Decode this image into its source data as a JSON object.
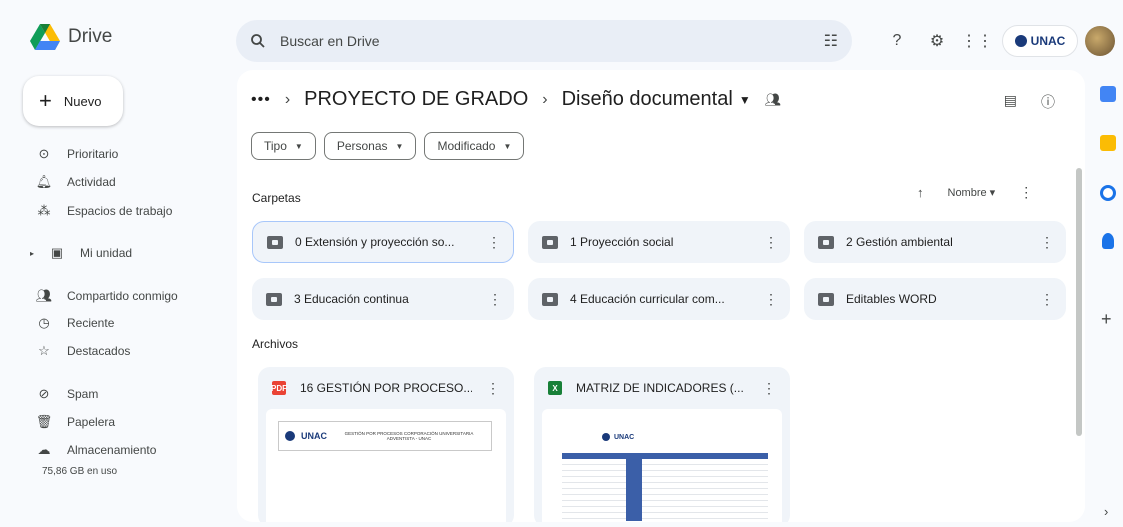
{
  "app": {
    "name": "Drive"
  },
  "search": {
    "placeholder": "Buscar en Drive"
  },
  "org": {
    "label": "UNAC"
  },
  "sidebar": {
    "new_label": "Nuevo",
    "items": [
      {
        "label": "Prioritario",
        "icon": "check-circle-icon"
      },
      {
        "label": "Actividad",
        "icon": "bell-icon"
      },
      {
        "label": "Espacios de trabajo",
        "icon": "workspaces-icon"
      },
      {
        "label": "Mi unidad",
        "icon": "my-drive-icon"
      },
      {
        "label": "Compartido conmigo",
        "icon": "shared-icon"
      },
      {
        "label": "Reciente",
        "icon": "clock-icon"
      },
      {
        "label": "Destacados",
        "icon": "star-icon"
      },
      {
        "label": "Spam",
        "icon": "spam-icon"
      },
      {
        "label": "Papelera",
        "icon": "trash-icon"
      },
      {
        "label": "Almacenamiento",
        "icon": "cloud-icon"
      }
    ],
    "storage_text": "75,86 GB en uso"
  },
  "breadcrumb": {
    "parent": "PROYECTO DE GRADO",
    "current": "Diseño documental"
  },
  "filters": [
    "Tipo",
    "Personas",
    "Modificado"
  ],
  "sections": {
    "folders": "Carpetas",
    "files": "Archivos"
  },
  "sort": {
    "label": "Nombre"
  },
  "folders": [
    {
      "name": "0 Extensión y proyección so..."
    },
    {
      "name": "1 Proyección social"
    },
    {
      "name": "2 Gestión ambiental"
    },
    {
      "name": "3 Educación continua"
    },
    {
      "name": "4 Educación curricular com..."
    },
    {
      "name": "Editables WORD"
    }
  ],
  "files": [
    {
      "name": "16 GESTIÓN POR PROCESO...",
      "type": "PDF",
      "type_color": "#ea4335",
      "thumb_title": "GESTIÓN POR PROCESOS CORPORACIÓN UNIVERSITARIA ADVENTISTA - UNAC",
      "thumb_logo": "UNAC"
    },
    {
      "name": "MATRIZ DE INDICADORES (...",
      "type": "X",
      "type_color": "#188038",
      "thumb_logo": "UNAC"
    }
  ]
}
